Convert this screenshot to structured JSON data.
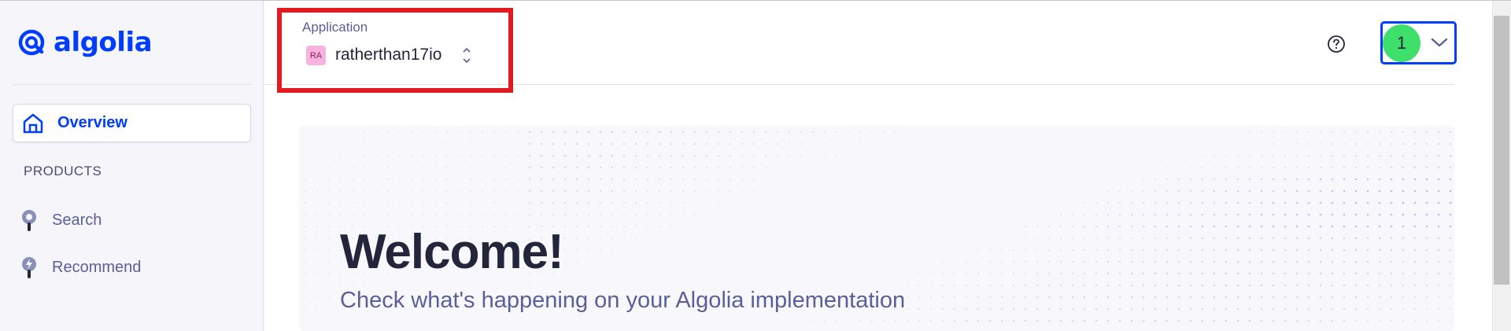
{
  "brand": {
    "name": "algolia",
    "color": "#003dff"
  },
  "sidebar": {
    "overview_label": "Overview",
    "section_title": "PRODUCTS",
    "items": [
      {
        "label": "Search",
        "icon": "search-product-icon"
      },
      {
        "label": "Recommend",
        "icon": "recommend-product-icon"
      }
    ]
  },
  "header": {
    "application_label": "Application",
    "app_badge": "RA",
    "app_name": "ratherthan17io",
    "help_icon": "help-circle-icon",
    "user_avatar": "1",
    "highlight_color": "#e01b22"
  },
  "hero": {
    "title": "Welcome!",
    "subtitle": "Check what's happening on your Algolia implementation"
  }
}
